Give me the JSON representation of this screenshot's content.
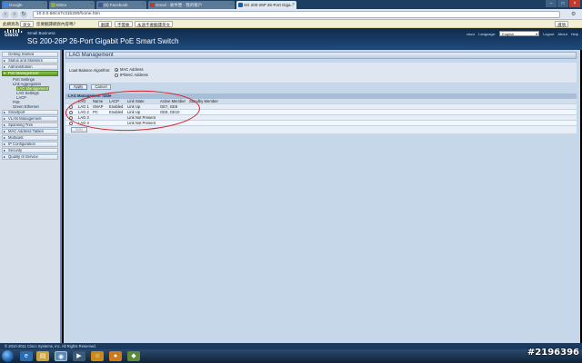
{
  "browser": {
    "tabs": [
      {
        "label": "Google",
        "active": false
      },
      {
        "label": "Mimo",
        "active": false
      },
      {
        "label": "(5) Facebook",
        "active": false
      },
      {
        "label": "Gmail - 收件匣 - 我的帳戶",
        "active": false
      },
      {
        "label": "SG 200-26P 26-Port Giga...",
        "active": true
      }
    ],
    "url": "10.0.0.66/cs7c31b200/home.htm",
    "translate_bar": {
      "text": "此網頁為",
      "lang": "英文",
      "question": "您要翻譯網頁內容嗎？",
      "translate_btn": "翻譯",
      "no_btn": "不需要",
      "never_btn": "永遠不要翻譯英文",
      "options_btn": "選項"
    }
  },
  "header": {
    "brand": "cisco",
    "small_business": "Small Business",
    "product": "SG 200-26P 26-Port Gigabit PoE Smart Switch",
    "links": [
      "cisco",
      "Language:"
    ],
    "language": "English",
    "logout": "Logout",
    "about": "About",
    "help": "Help"
  },
  "sidebar": {
    "items": [
      {
        "label": "Getting Started",
        "active": false
      },
      {
        "label": "Status and Statistics",
        "active": false
      },
      {
        "label": "Administration",
        "active": false
      },
      {
        "label": "Port Management",
        "active": true
      }
    ],
    "port_sub": [
      {
        "label": "Port Settings",
        "level": 1
      },
      {
        "label": "Link Aggregation",
        "level": 1
      },
      {
        "label": "LAG Management",
        "level": 2,
        "selected": true
      },
      {
        "label": "LAG Settings",
        "level": 2
      },
      {
        "label": "LACP",
        "level": 2
      },
      {
        "label": "PoE",
        "level": 1
      },
      {
        "label": "Green Ethernet",
        "level": 1
      }
    ],
    "items_after": [
      {
        "label": "Smartport"
      },
      {
        "label": "VLAN Management"
      },
      {
        "label": "Spanning Tree"
      },
      {
        "label": "MAC Address Tables"
      },
      {
        "label": "Multicast"
      },
      {
        "label": "IP Configuration"
      },
      {
        "label": "Security"
      },
      {
        "label": "Quality of Service"
      }
    ]
  },
  "content": {
    "title": "LAG Management",
    "load_balance_label": "Load Balance Algorithm:",
    "options": [
      {
        "label": "MAC Address",
        "checked": true
      },
      {
        "label": "IP/MAC Address",
        "checked": false
      }
    ],
    "apply": "Apply",
    "cancel": "Cancel",
    "table_title": "LAG Management Table",
    "columns": [
      "LAG",
      "Name",
      "LACP",
      "Link State",
      "Active Member",
      "Standby Member"
    ],
    "rows": [
      {
        "lag": "LAG 1",
        "name": "SNAP",
        "lacp": "Enabled",
        "link": "Link Up",
        "active": "GE7, GE8",
        "standby": ""
      },
      {
        "lag": "LAG 2",
        "name": "PC",
        "lacp": "Enabled",
        "link": "Link Up",
        "active": "GE9, GE10",
        "standby": ""
      },
      {
        "lag": "LAG 3",
        "name": "",
        "lacp": "",
        "link": "Link Not Present",
        "active": "",
        "standby": ""
      },
      {
        "lag": "LAG 4",
        "name": "",
        "lacp": "",
        "link": "Link Not Present",
        "active": "",
        "standby": ""
      }
    ],
    "edit": "Edit"
  },
  "footer": "© 2010-2011 Cisco Systems, Inc. All Rights Reserved.",
  "watermark": "#2196396"
}
